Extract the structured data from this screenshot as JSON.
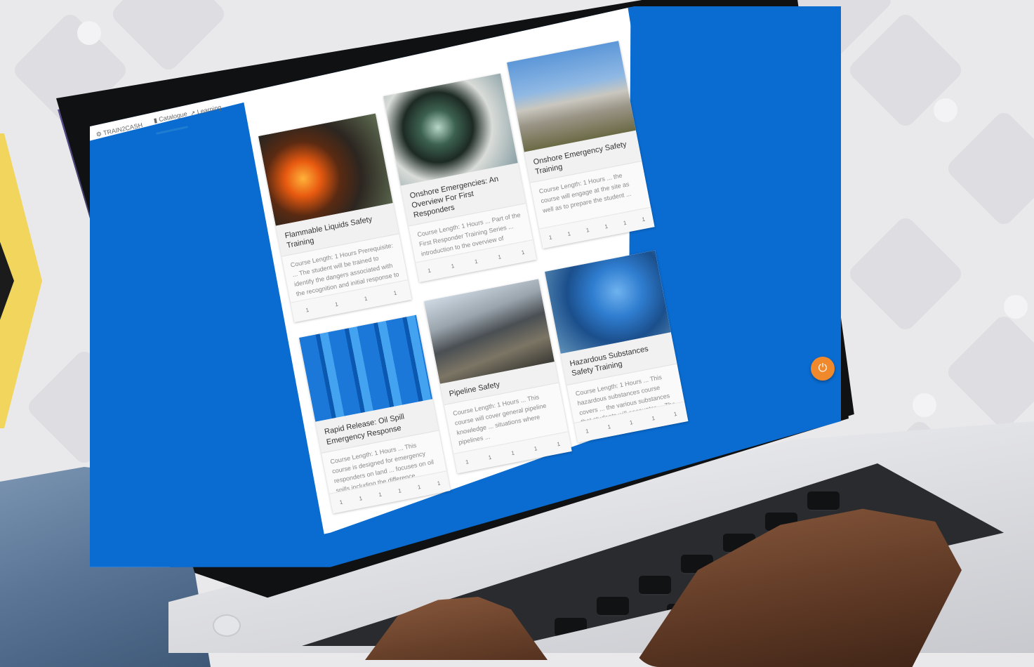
{
  "background": {
    "accent_color": "#f2d55c",
    "screen_blue": "#0a6bd0",
    "fab_color": "#f0892c"
  },
  "app": {
    "nav_items": [
      {
        "label": "TRAIN2CASH",
        "icon": "logo-icon"
      },
      {
        "label": "Catalogue",
        "icon": "book-icon"
      },
      {
        "label": "Learning",
        "icon": "share-icon"
      }
    ]
  },
  "cards": [
    {
      "title": "Flammable Liquids Safety Training",
      "desc": "Course Length: 1 Hours Prerequisite: ... The student will be trained to identify the dangers associated with the recognition and initial response to a flammable liquids...",
      "image": "fire-fighter-image",
      "footer": [
        "1",
        "1",
        "1",
        "1"
      ]
    },
    {
      "title": "Onshore Emergencies: An Overview For First Responders",
      "desc": "Course Length: 1 Hours ... Part of the First Responder Training Series ... introduction to the overview of emergency ... responders are prepared to assist in those situations ...",
      "image": "tank-inspection-image",
      "footer": [
        "1",
        "1",
        "1",
        "1",
        "1"
      ]
    },
    {
      "title": "Onshore Emergency Safety Training",
      "desc": "Course Length: 1 Hours ... the course will engage at the site as well as to prepare the student ...",
      "image": "refinery-image",
      "footer": [
        "1",
        "1",
        "1",
        "1",
        "1",
        "1"
      ]
    },
    {
      "title": "Rapid Release: Oil Spill Emergency Response",
      "desc": "Course Length: 1 Hours ... This course is designed for emergency responders on land ... focuses on oil spills including the difference...",
      "image": "barrels-image",
      "footer": [
        "1",
        "1",
        "1",
        "1",
        "1",
        "1"
      ]
    },
    {
      "title": "Pipeline Safety",
      "desc": "Course Length: 1 Hours ... This course will cover general pipeline knowledge ... situations where pipelines ...",
      "image": "pipeline-image",
      "footer": [
        "1",
        "1",
        "1",
        "1",
        "1"
      ]
    },
    {
      "title": "Hazardous Substances Safety Training",
      "desc": "Course Length: 1 Hours ... This hazardous substances course covers ... the various substances that students will encounter ... The course is designed ...",
      "image": "hazmat-image",
      "footer": [
        "1",
        "1",
        "1",
        "1",
        "1"
      ]
    }
  ],
  "fab": {
    "icon": "power-icon",
    "glyph": "⏻"
  }
}
